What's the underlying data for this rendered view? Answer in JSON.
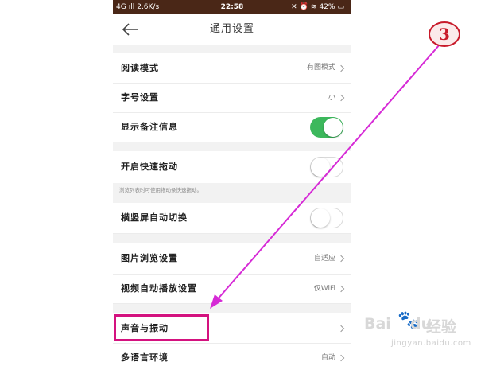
{
  "status_bar": {
    "network": "4G",
    "speed": "2.6K/s",
    "time": "22:58",
    "battery": "42%",
    "icons": [
      "signal-icon",
      "mute-icon",
      "alarm-icon",
      "wifi-icon",
      "battery-icon"
    ]
  },
  "header": {
    "title": "通用设置",
    "back_icon": "arrow-left-icon"
  },
  "settings": {
    "reading_mode": {
      "label": "阅读模式",
      "value": "有图模式"
    },
    "font_size": {
      "label": "字号设置",
      "value": "小"
    },
    "show_notes": {
      "label": "显示备注信息",
      "state": "on"
    },
    "quick_scroll": {
      "label": "开启快速拖动",
      "state": "off",
      "hint": "浏览列表时可使用拖动条快速拖动。"
    },
    "auto_rotate": {
      "label": "横竖屏自动切换",
      "state": "off"
    },
    "image_browse": {
      "label": "图片浏览设置",
      "value": "自适应"
    },
    "video_autoplay": {
      "label": "视频自动播放设置",
      "value": "仅WiFi"
    },
    "sound_vibration": {
      "label": "声音与振动"
    },
    "language": {
      "label": "多语言环境",
      "value": "自动"
    }
  },
  "annotation": {
    "step_number": "3",
    "accent": "#d4127f",
    "badge_color": "#c81a2a"
  },
  "watermark": {
    "brand_en_1": "Bai",
    "brand_en_2": "du",
    "brand_cn": "经验",
    "url": "jingyan.baidu.com"
  },
  "colors": {
    "status_bar_bg": "#4a2717",
    "toggle_on": "#3cb85c",
    "page_bg": "#f2f2f2"
  }
}
